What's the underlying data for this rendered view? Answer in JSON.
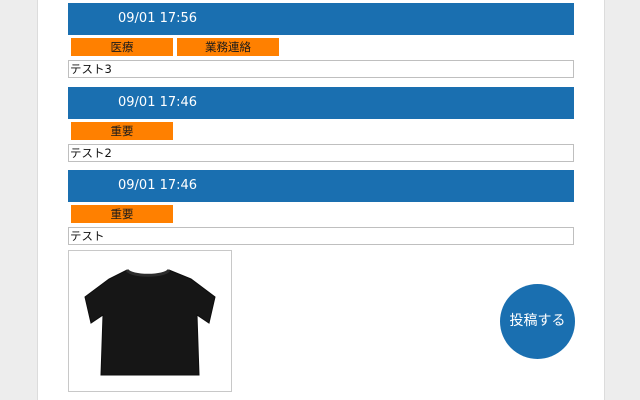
{
  "posts": [
    {
      "timestamp": "09/01 17:56",
      "tags": [
        "医療",
        "業務連絡"
      ],
      "body": "テスト3"
    },
    {
      "timestamp": "09/01 17:46",
      "tags": [
        "重要"
      ],
      "body": "テスト2"
    },
    {
      "timestamp": "09/01 17:46",
      "tags": [
        "重要"
      ],
      "body": "テスト",
      "image": {
        "icon": "black-tshirt-image"
      }
    }
  ],
  "post_button": {
    "label": "投稿する"
  },
  "colors": {
    "header": "#1a6fb0",
    "tag": "#ff8000",
    "background": "#ededed"
  }
}
